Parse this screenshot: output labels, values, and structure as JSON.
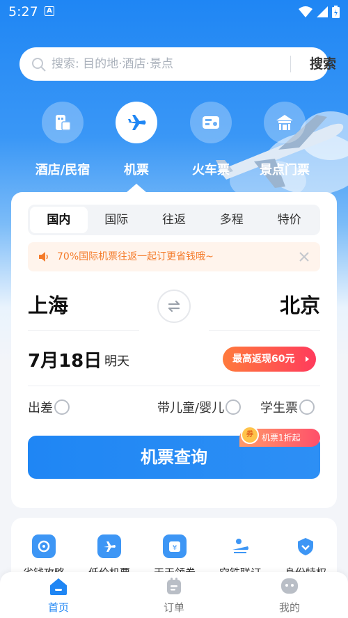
{
  "status": {
    "time": "5:27",
    "notice_letter": "A"
  },
  "search": {
    "placeholder": "搜索: 目的地·酒店·景点",
    "button": "搜索"
  },
  "categories": [
    {
      "label": "酒店/民宿",
      "icon": "hotel-icon"
    },
    {
      "label": "机票",
      "icon": "plane-icon",
      "active": true
    },
    {
      "label": "火车票",
      "icon": "train-ticket-icon"
    },
    {
      "label": "景点门票",
      "icon": "scenic-spot-icon"
    }
  ],
  "booking": {
    "tabs": [
      "国内",
      "国际",
      "往返",
      "多程",
      "特价"
    ],
    "active_tab": "国内",
    "notice": "70%国际机票往返一起订更省钱哦~",
    "from_city": "上海",
    "to_city": "北京",
    "date": "7月18日",
    "date_sub": "明天",
    "cashback": "最高返现60元",
    "options": [
      "出差",
      "带儿童/婴儿",
      "学生票"
    ],
    "search_button": "机票查询",
    "promo_tag": "机票1折起",
    "promo_coin": "券"
  },
  "services": [
    {
      "label": "省钱攻略",
      "icon": "savings-icon"
    },
    {
      "label": "低价机票",
      "icon": "cheap-ticket-icon"
    },
    {
      "label": "天天领券",
      "icon": "coupon-icon"
    },
    {
      "label": "空铁联订",
      "icon": "air-rail-icon"
    },
    {
      "label": "身份特权",
      "icon": "privilege-icon"
    }
  ],
  "bottom_nav": [
    {
      "label": "首页",
      "icon": "home-icon",
      "active": true
    },
    {
      "label": "订单",
      "icon": "order-icon"
    },
    {
      "label": "我的",
      "icon": "profile-icon"
    }
  ],
  "colors": {
    "primary": "#1f86f4",
    "accent_orange": "#f47b2a",
    "cashback_start": "#ff7a3c",
    "cashback_end": "#ff3b5c"
  }
}
